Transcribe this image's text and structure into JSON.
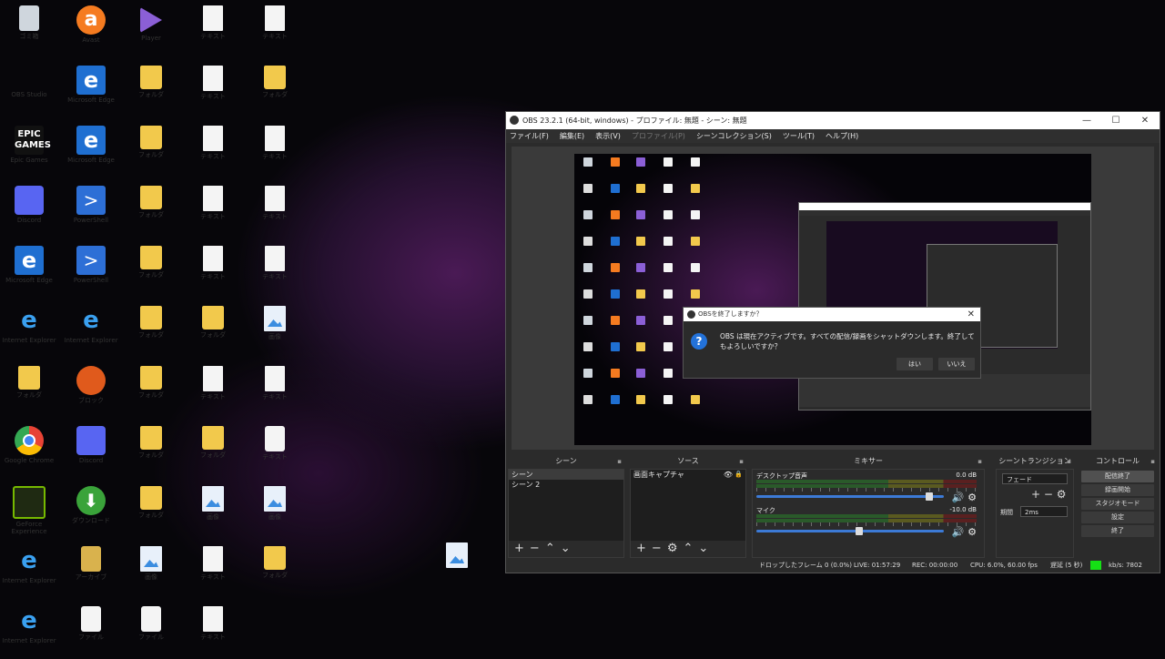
{
  "desktop": {
    "icons_col": [
      "ゴミ箱",
      "Avast",
      "Player",
      "テキスト",
      "テキスト",
      "OBS Studio",
      "Microsoft Edge",
      "フォルダ",
      "テキスト",
      "フォルダ",
      "Epic Games",
      "Microsoft Edge",
      "フォルダ",
      "テキスト",
      "テキスト",
      "Discord",
      "PowerShell",
      "フォルダ",
      "テキスト",
      "テキスト",
      "Microsoft Edge",
      "PowerShell",
      "フォルダ",
      "テキスト",
      "テキスト",
      "Internet Explorer",
      "Internet Explorer",
      "フォルダ",
      "フォルダ",
      "画像",
      "フォルダ",
      "ブロック",
      "フォルダ",
      "テキスト",
      "テキスト",
      "Google Chrome",
      "Discord",
      "フォルダ",
      "フォルダ",
      "テキスト",
      "GeForce Experience",
      "ダウンロード",
      "フォルダ",
      "画像",
      "画像",
      "Internet Explorer",
      "アーカイブ",
      "画像",
      "テキスト",
      "フォルダ",
      "Internet Explorer",
      "ファイル",
      "ファイル",
      "テキスト"
    ],
    "logo_epic": "EPIC\nGAMES"
  },
  "obs": {
    "title": "OBS 23.2.1 (64-bit, windows) - プロファイル: 無題 - シーン: 無題",
    "win_min": "—",
    "win_max": "☐",
    "win_close": "✕",
    "menu": [
      "ファイル(F)",
      "編集(E)",
      "表示(V)",
      "プロファイル(P)",
      "シーンコレクション(S)",
      "ツール(T)",
      "ヘルプ(H)"
    ],
    "panels": {
      "scenes_title": "シーン",
      "scenes": [
        "シーン",
        "シーン 2"
      ],
      "sources_title": "ソース",
      "sources": [
        "画面キャプチャ"
      ],
      "mixer_title": "ミキサー",
      "mixer": [
        {
          "name": "デスクトップ音声",
          "db": "0.0 dB",
          "volume": 0.92
        },
        {
          "name": "マイク",
          "db": "-10.0 dB",
          "volume": 0.55
        }
      ],
      "transitions_title": "シーントランジション",
      "transition_value": "フェード",
      "duration_label": "期間",
      "duration_value": "2ms",
      "controls_title": "コントロール",
      "controls": [
        "配信終了",
        "録画開始",
        "スタジオモード",
        "設定",
        "終了"
      ]
    },
    "status": {
      "dropped": "ドロップしたフレーム 0 (0.0%)",
      "live": "LIVE: 01:57:29",
      "rec": "REC: 00:00:00",
      "cpu": "CPU: 6.0%, 60.00 fps",
      "delay": "遅延 (5 秒)",
      "kbps": "kb/s: 7802"
    }
  },
  "dialog": {
    "title": "OBSを終了しますか？",
    "message": "OBS は現在アクティブです。すべての配信/録画をシャットダウンします。終了してもよろしいですか？",
    "yes": "はい",
    "no": "いいえ",
    "close": "✕",
    "icon": "?"
  },
  "colors": {
    "accent": "#2372d9",
    "meter_green": "#15e015"
  }
}
